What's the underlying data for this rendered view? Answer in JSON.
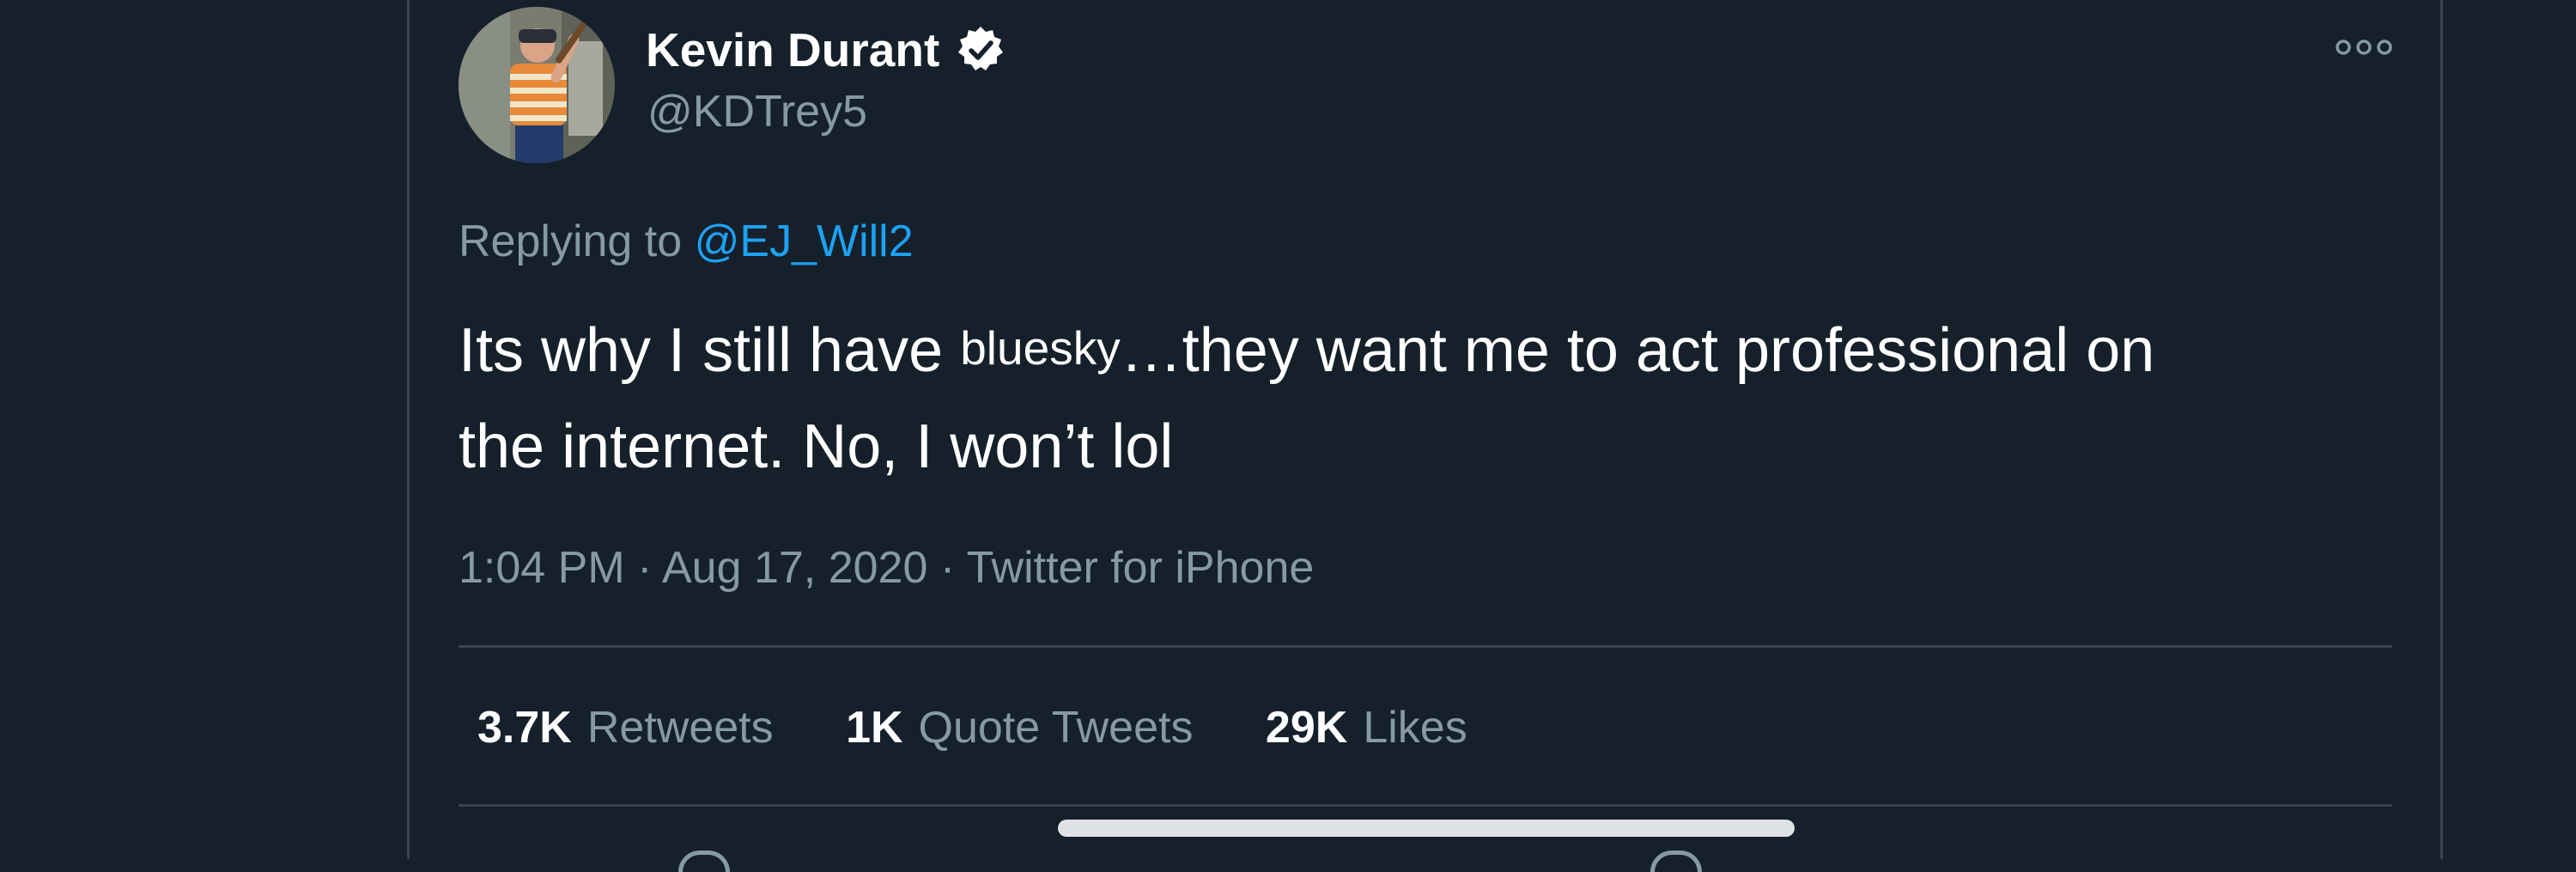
{
  "tweet": {
    "author": {
      "display_name": "Kevin Durant",
      "handle": "@KDTrey5",
      "verified": true
    },
    "replying_to_prefix": "Replying to ",
    "replying_to_handle": "@EJ_Will2",
    "text_part1": "Its why I still have ",
    "text_small_word": "bluesky",
    "text_part2": "…they want me to act professional on",
    "text_line2": "the internet. No, I won’t lol",
    "timestamp": "1:04 PM · Aug 17, 2020 · Twitter for iPhone"
  },
  "stats": [
    {
      "count": "3.7K",
      "label": "Retweets"
    },
    {
      "count": "1K",
      "label": "Quote Tweets"
    },
    {
      "count": "29K",
      "label": "Likes"
    }
  ],
  "icons": {
    "more": "more-options-icon",
    "verified": "verified-badge-icon"
  },
  "colors": {
    "background": "#15202b",
    "text_primary": "#ffffff",
    "text_secondary": "#8899a6",
    "link": "#1da1f2",
    "divider": "#38444d"
  }
}
